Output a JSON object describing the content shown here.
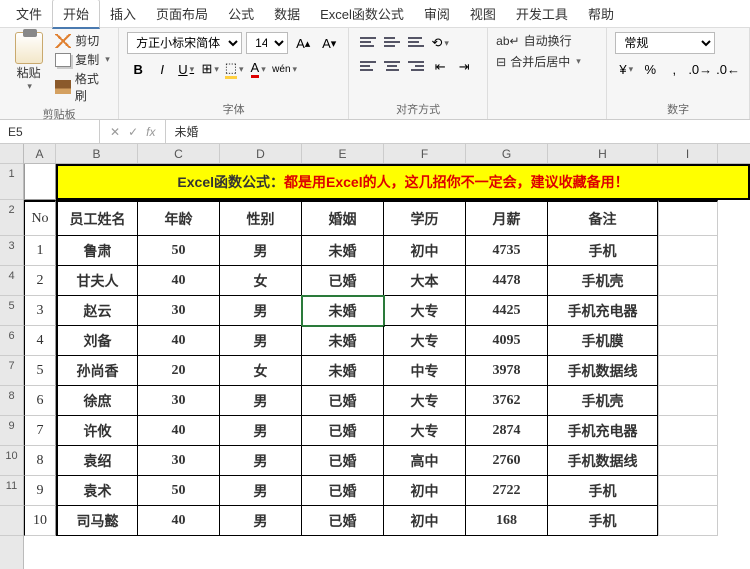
{
  "menu": {
    "file": "文件",
    "home": "开始",
    "insert": "插入",
    "layout": "页面布局",
    "formula": "公式",
    "data": "数据",
    "excelfx": "Excel函数公式",
    "review": "审阅",
    "view": "视图",
    "dev": "开发工具",
    "help": "帮助"
  },
  "ribbon": {
    "clipboard": {
      "paste": "粘贴",
      "cut": "剪切",
      "copy": "复制",
      "brush": "格式刷",
      "label": "剪贴板"
    },
    "font": {
      "name": "方正小标宋简体",
      "size": "14",
      "label": "字体"
    },
    "align": {
      "wrap": "自动换行",
      "merge": "合并后居中",
      "label": "对齐方式"
    },
    "number": {
      "format": "常规",
      "label": "数字"
    }
  },
  "fbar": {
    "name": "E5",
    "fx": "未婚"
  },
  "cols": [
    "A",
    "B",
    "C",
    "D",
    "E",
    "F",
    "G",
    "H",
    "I"
  ],
  "rownums": [
    "1",
    "2",
    "3",
    "4",
    "5",
    "6",
    "7",
    "8",
    "9",
    "10",
    "11",
    ""
  ],
  "banner": {
    "p1": "Excel函数公式：",
    "p2": "都是用Excel的人，这几招你不一定会，建议收藏备用！"
  },
  "headers": {
    "no": "No",
    "name": "员工姓名",
    "age": "年龄",
    "sex": "性别",
    "mar": "婚姻",
    "edu": "学历",
    "sal": "月薪",
    "note": "备注"
  },
  "rows": [
    {
      "no": "1",
      "name": "鲁肃",
      "age": "50",
      "sex": "男",
      "mar": "未婚",
      "edu": "初中",
      "sal": "4735",
      "note": "手机"
    },
    {
      "no": "2",
      "name": "甘夫人",
      "age": "40",
      "sex": "女",
      "mar": "已婚",
      "edu": "大本",
      "sal": "4478",
      "note": "手机壳"
    },
    {
      "no": "3",
      "name": "赵云",
      "age": "30",
      "sex": "男",
      "mar": "未婚",
      "edu": "大专",
      "sal": "4425",
      "note": "手机充电器"
    },
    {
      "no": "4",
      "name": "刘备",
      "age": "40",
      "sex": "男",
      "mar": "未婚",
      "edu": "大专",
      "sal": "4095",
      "note": "手机膜"
    },
    {
      "no": "5",
      "name": "孙尚香",
      "age": "20",
      "sex": "女",
      "mar": "未婚",
      "edu": "中专",
      "sal": "3978",
      "note": "手机数据线"
    },
    {
      "no": "6",
      "name": "徐庶",
      "age": "30",
      "sex": "男",
      "mar": "已婚",
      "edu": "大专",
      "sal": "3762",
      "note": "手机壳"
    },
    {
      "no": "7",
      "name": "许攸",
      "age": "40",
      "sex": "男",
      "mar": "已婚",
      "edu": "大专",
      "sal": "2874",
      "note": "手机充电器"
    },
    {
      "no": "8",
      "name": "袁绍",
      "age": "30",
      "sex": "男",
      "mar": "已婚",
      "edu": "高中",
      "sal": "2760",
      "note": "手机数据线"
    },
    {
      "no": "9",
      "name": "袁术",
      "age": "50",
      "sex": "男",
      "mar": "已婚",
      "edu": "初中",
      "sal": "2722",
      "note": "手机"
    },
    {
      "no": "10",
      "name": "司马懿",
      "age": "40",
      "sex": "男",
      "mar": "已婚",
      "edu": "初中",
      "sal": "168",
      "note": "手机"
    }
  ]
}
